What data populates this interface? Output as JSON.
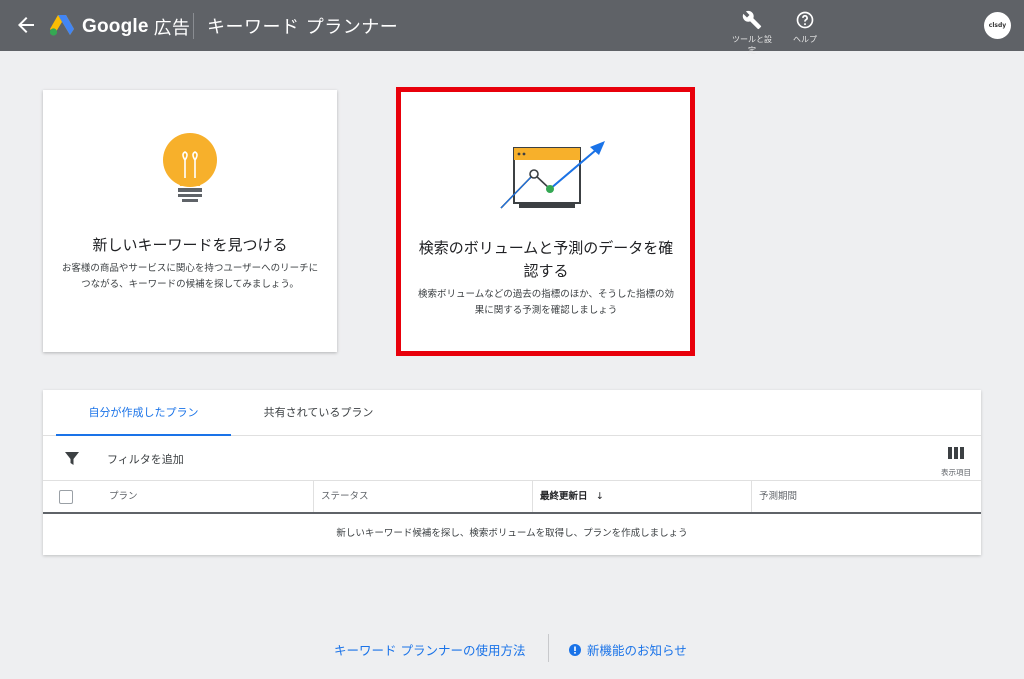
{
  "header": {
    "brand_google": "Google",
    "brand_ads": "広告",
    "tool_title": "キーワード プランナー",
    "tools_label": "ツールと設定",
    "help_label": "ヘルプ",
    "avatar_text": "clsdy"
  },
  "cards": {
    "discover": {
      "title": "新しいキーワードを見つける",
      "description": "お客様の商品やサービスに関心を持つユーザーへのリーチにつながる、キーワードの候補を探してみましょう。"
    },
    "forecast": {
      "title": "検索のボリュームと予測のデータを確認する",
      "description": "検索ボリュームなどの過去の指標のほか、そうした指標の効果に関する予測を確認しましょう"
    }
  },
  "plans": {
    "tabs": [
      "自分が作成したプラン",
      "共有されているプラン"
    ],
    "filter_label": "フィルタを追加",
    "columns_button": "表示項目",
    "columns": {
      "plan": "プラン",
      "status": "ステータス",
      "last_updated": "最終更新日",
      "forecast_period": "予測期間"
    },
    "sort_arrow": "↓",
    "empty_message": "新しいキーワード候補を探し、検索ボリュームを取得し、プランを作成しましょう"
  },
  "footer": {
    "howto_link": "キーワード プランナーの使用方法",
    "news_link": "新機能のお知らせ"
  },
  "colors": {
    "header_bg": "#5f6267",
    "accent_blue": "#1a73e8",
    "highlight_red": "#e8000b",
    "bulb_yellow": "#f7b02b"
  }
}
